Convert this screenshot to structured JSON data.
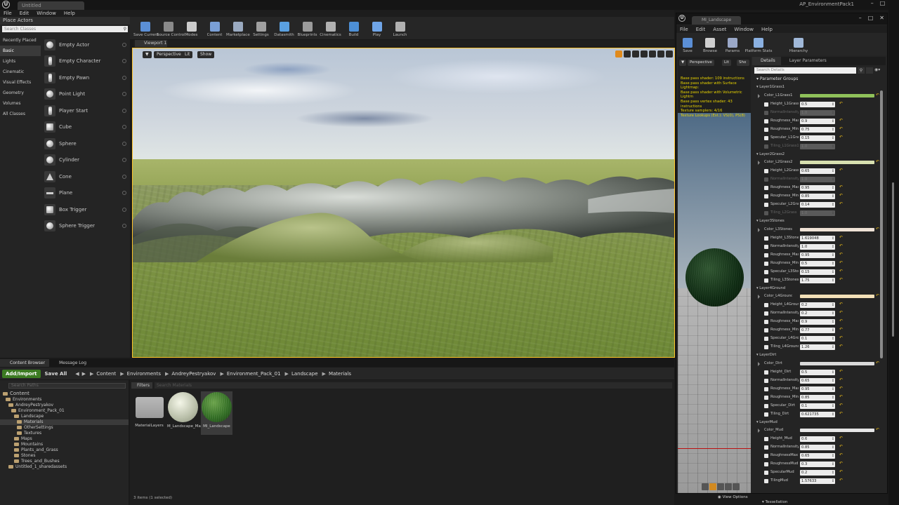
{
  "editor": {
    "tab_title": "Untitled",
    "project": "AP_EnvironmentPack1",
    "menu": [
      "File",
      "Edit",
      "Window",
      "Help"
    ]
  },
  "place_actors": {
    "header": "Place Actors",
    "search_placeholder": "Search Classes",
    "categories": [
      "Recently Placed",
      "Basic",
      "Lights",
      "Cinematic",
      "Visual Effects",
      "Geometry",
      "Volumes",
      "All Classes"
    ],
    "active_category": "Basic",
    "items": [
      "Empty Actor",
      "Empty Character",
      "Empty Pawn",
      "Point Light",
      "Player Start",
      "Cube",
      "Sphere",
      "Cylinder",
      "Cone",
      "Plane",
      "Box Trigger",
      "Sphere Trigger"
    ]
  },
  "toolbar": {
    "buttons": [
      {
        "label": "Save Current",
        "color": "#5b8fd6"
      },
      {
        "label": "Source Control",
        "color": "#8a8a8a"
      },
      {
        "label": "Modes",
        "color": "#cccccc"
      },
      {
        "label": "Content",
        "color": "#7a9fd6"
      },
      {
        "label": "Marketplace",
        "color": "#9aaac0"
      },
      {
        "label": "Settings",
        "color": "#a0a0a0"
      },
      {
        "label": "Datasmith",
        "color": "#5aa0e0"
      },
      {
        "label": "Blueprints",
        "color": "#9b9b9b"
      },
      {
        "label": "Cinematics",
        "color": "#b0b0b0"
      },
      {
        "label": "Build",
        "color": "#4d8fd6"
      },
      {
        "label": "Play",
        "color": "#6fa5e8"
      },
      {
        "label": "Launch",
        "color": "#b0b0b0"
      }
    ]
  },
  "viewport": {
    "tab": "Viewport 1",
    "perspective": "Perspective",
    "lit": "Lit",
    "show": "Show"
  },
  "content_browser": {
    "tabs": [
      "Content Browser",
      "Message Log"
    ],
    "add_import": "Add/Import",
    "save_all": "Save All",
    "breadcrumb": [
      "Content",
      "Environments",
      "AndreyPestryakov",
      "Environment_Pack_01",
      "Landscape",
      "Materials"
    ],
    "search_paths": "Search Paths",
    "filters": "Filters",
    "search_materials": "Search Materials",
    "tree": [
      {
        "label": "Content",
        "depth": 0,
        "big": true
      },
      {
        "label": "Environments",
        "depth": 1
      },
      {
        "label": "AndreyPestryakov",
        "depth": 2
      },
      {
        "label": "Environment_Pack_01",
        "depth": 3
      },
      {
        "label": "Landscape",
        "depth": 4
      },
      {
        "label": "Materials",
        "depth": 5,
        "selected": true
      },
      {
        "label": "OtherSettings",
        "depth": 5
      },
      {
        "label": "Textures",
        "depth": 5
      },
      {
        "label": "Maps",
        "depth": 4
      },
      {
        "label": "Mountains",
        "depth": 4
      },
      {
        "label": "Plants_and_Grass",
        "depth": 4
      },
      {
        "label": "Stones",
        "depth": 4
      },
      {
        "label": "Trees_and_Bushes",
        "depth": 4
      },
      {
        "label": "Untitled_1_sharedassets",
        "depth": 2
      }
    ],
    "assets": [
      {
        "label": "MaterialLayers",
        "kind": "folder"
      },
      {
        "label": "M_Landscape_Material",
        "kind": "material"
      },
      {
        "label": "MI_Landscape",
        "kind": "instance",
        "selected": true
      }
    ],
    "status": "3 items (1 selected)"
  },
  "material_editor": {
    "tab_title": "MI_Landscape",
    "menu": [
      "File",
      "Edit",
      "Asset",
      "Window",
      "Help"
    ],
    "toolbar": [
      "Save",
      "Browse",
      "Params",
      "Platform Stats",
      "Hierarchy"
    ],
    "preview": {
      "perspective": "Perspective",
      "lit": "Lit",
      "show": "Sho",
      "stats": [
        "Base pass shader: 109 instructions",
        "Base pass shader with Surface Lightmap:",
        "Base pass shader with Volumetric Lightm",
        "Base pass vertex shader: 43 instructions",
        "Texture samplers: 4/16",
        "Texture Lookups (Est.): VS(0), PS(8)"
      ]
    },
    "tabs": [
      "Details",
      "Layer Parameters"
    ],
    "search_placeholder": "Search Details",
    "param_groups": "Parameter Groups",
    "groups": [
      {
        "name": "Layer1Grass1",
        "color": "#8fc15a",
        "rows": [
          {
            "name": "Color_L1Grass1",
            "type": "color"
          },
          {
            "name": "Height_L1Grass",
            "value": "0.5"
          },
          {
            "name": "NormalIntensity",
            "value": "1.0",
            "dim": true
          },
          {
            "name": "Roughness_Max",
            "value": "0.9"
          },
          {
            "name": "Roughness_Min",
            "value": "0.75"
          },
          {
            "name": "Specular_L1Gras",
            "value": "0.15"
          },
          {
            "name": "Tiling_L1Grass1",
            "value": "1.0",
            "dim": true
          }
        ]
      },
      {
        "name": "Layer2Grass2",
        "color": "#d8e0b0",
        "rows": [
          {
            "name": "Color_L2Grass2",
            "type": "color"
          },
          {
            "name": "Height_L2Grass",
            "value": "0.65"
          },
          {
            "name": "NormalIntensity",
            "value": "1.0",
            "dim": true
          },
          {
            "name": "Roughness_Max",
            "value": "0.95"
          },
          {
            "name": "Roughness_Min",
            "value": "0.85"
          },
          {
            "name": "Specular_L2Gra",
            "value": "0.14"
          },
          {
            "name": "Tiling_L2Grass",
            "value": "1.0",
            "dim": true
          }
        ]
      },
      {
        "name": "Layer3Stones",
        "color": "#efe2d6",
        "rows": [
          {
            "name": "Color_L3Stones",
            "type": "color"
          },
          {
            "name": "Height_L3Stone",
            "value": "1.619048"
          },
          {
            "name": "NormalIntensity",
            "value": "1.0"
          },
          {
            "name": "Roughness_Max",
            "value": "0.95"
          },
          {
            "name": "Roughness_Min",
            "value": "0.5"
          },
          {
            "name": "Specular_L3Sto",
            "value": "0.15"
          },
          {
            "name": "Tiling_L3Stones",
            "value": "1.75"
          }
        ]
      },
      {
        "name": "Layer4Ground",
        "color": "#f3e0b8",
        "rows": [
          {
            "name": "Color_L4Ground",
            "type": "color"
          },
          {
            "name": "Height_L4Groun",
            "value": "0.2"
          },
          {
            "name": "NormalIntensity",
            "value": "0.2"
          },
          {
            "name": "Roughness_Max",
            "value": "0.9"
          },
          {
            "name": "Roughness_Min",
            "value": "0.77"
          },
          {
            "name": "Specular_L4Gro",
            "value": "0.1"
          },
          {
            "name": "Tiling_L4Ground",
            "value": "1.26"
          }
        ]
      },
      {
        "name": "LayerDirt",
        "color": "#dadada",
        "rows": [
          {
            "name": "Color_Dirt",
            "type": "color"
          },
          {
            "name": "Height_Dirt",
            "value": "0.5"
          },
          {
            "name": "NormalIntensity",
            "value": "0.65"
          },
          {
            "name": "Roughness_Max",
            "value": "0.95"
          },
          {
            "name": "Roughness_Min",
            "value": "0.85"
          },
          {
            "name": "Specular_Dirt",
            "value": "0.1"
          },
          {
            "name": "Tiling_Dirt",
            "value": "0.621735"
          }
        ]
      },
      {
        "name": "LayerMud",
        "color": "#e6e6e6",
        "rows": [
          {
            "name": "Color_Mud",
            "type": "color"
          },
          {
            "name": "Height_Mud",
            "value": "0.6"
          },
          {
            "name": "NormalIntensity",
            "value": "0.85"
          },
          {
            "name": "RoughnessMax",
            "value": "0.65"
          },
          {
            "name": "RoughnessMud",
            "value": "0.3"
          },
          {
            "name": "SpecularMud",
            "value": "0.2"
          },
          {
            "name": "TilingMud",
            "value": "1.57633"
          }
        ]
      }
    ],
    "view_options": "View Options",
    "tessellation": "Tessellation"
  }
}
